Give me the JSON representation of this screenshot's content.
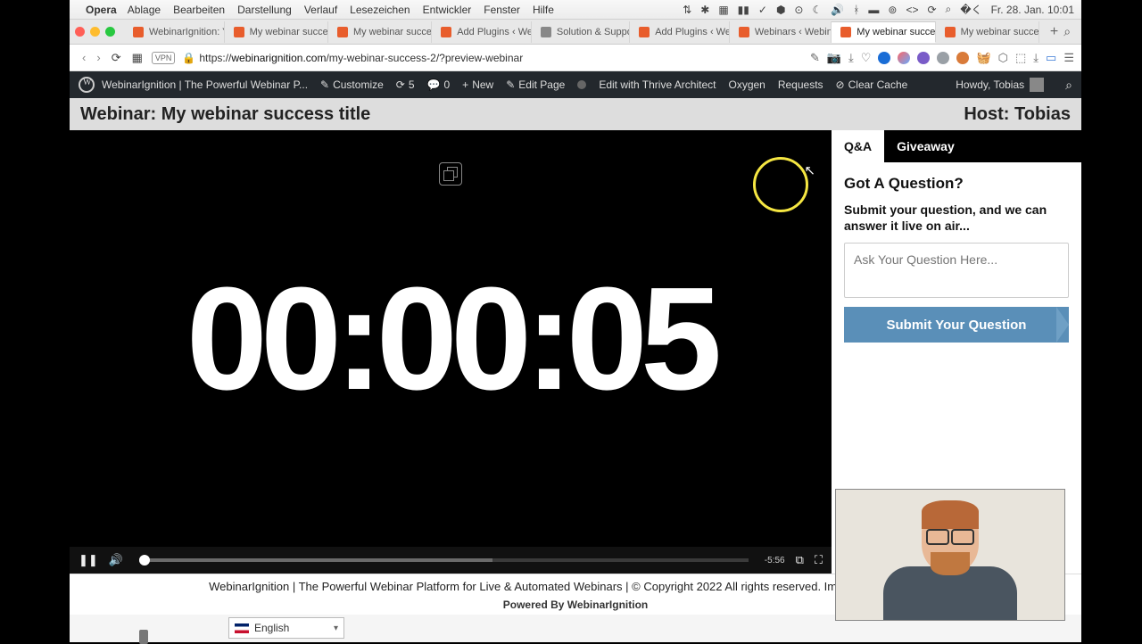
{
  "mac_menu": {
    "app": "Opera",
    "items": [
      "Ablage",
      "Bearbeiten",
      "Darstellung",
      "Verlauf",
      "Lesezeichen",
      "Entwickler",
      "Fenster",
      "Hilfe"
    ],
    "clock": "Fr. 28. Jan.  10:01"
  },
  "tabs": [
    {
      "label": "WebinarIgnition: Yo"
    },
    {
      "label": "My webinar success"
    },
    {
      "label": "My webinar success"
    },
    {
      "label": "Add Plugins ‹ Webi"
    },
    {
      "label": "Solution & Support",
      "neutral": true
    },
    {
      "label": "Add Plugins ‹ Webi"
    },
    {
      "label": "Webinars ‹ Webinar"
    },
    {
      "label": "My webinar success",
      "active": true
    },
    {
      "label": "My webinar success"
    }
  ],
  "url": {
    "scheme": "https://",
    "domain": "webinarignition.com",
    "path": "/my-webinar-success-2/?preview-webinar"
  },
  "wpbar": {
    "site": "WebinarIgnition | The Powerful Webinar P...",
    "customize": "Customize",
    "updates": "5",
    "comments": "0",
    "new": "New",
    "edit_page": "Edit Page",
    "edit_thrive": "Edit with Thrive Architect",
    "oxygen": "Oxygen",
    "requests": "Requests",
    "clear_cache": "Clear Cache",
    "howdy": "Howdy, Tobias"
  },
  "header": {
    "title": "Webinar: My webinar success title",
    "host": "Host: Tobias"
  },
  "video": {
    "timer": "00:00:05",
    "time_remaining": "-5:56"
  },
  "sidebar": {
    "tab_qa": "Q&A",
    "tab_giveaway": "Giveaway",
    "qa_title": "Got A Question?",
    "qa_sub": "Submit your question, and we can answer it live on air...",
    "qa_placeholder": "Ask Your Question Here...",
    "qa_submit": "Submit Your Question"
  },
  "footer": {
    "line1": "WebinarIgnition | The Powerful Webinar Platform for Live & Automated Webinars | © Copyright 2022 All rights reserved. Imprint - Privacy Policy",
    "line2": "Powered By WebinarIgnition"
  },
  "lang": {
    "label": "English"
  }
}
